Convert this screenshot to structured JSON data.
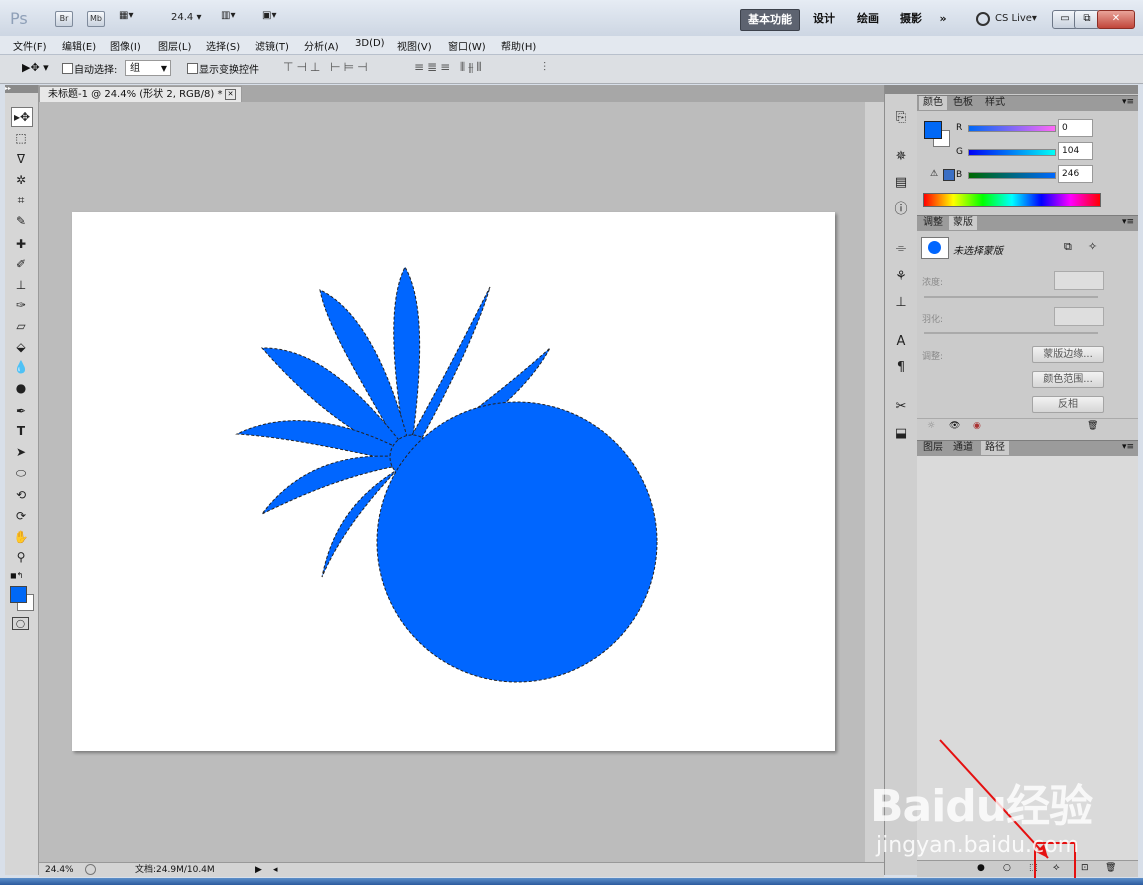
{
  "app": {
    "logo": "Ps",
    "bridge_label": "Br",
    "minibridge_label": "Mb",
    "zoom_value": "24.4",
    "workspaces": [
      "基本功能",
      "设计",
      "绘画",
      "摄影"
    ],
    "more_label": "»",
    "cslive_label": "CS Live▾"
  },
  "menu": [
    "文件(F)",
    "编辑(E)",
    "图像(I)",
    "图层(L)",
    "选择(S)",
    "滤镜(T)",
    "分析(A)",
    "3D(D)",
    "视图(V)",
    "窗口(W)",
    "帮助(H)"
  ],
  "options": {
    "auto_select_label": "自动选择:",
    "auto_select_value": "组",
    "show_transform_label": "显示变换控件"
  },
  "document": {
    "tab_title": "未标题-1 @ 24.4% (形状 2, RGB/8) *",
    "status_zoom": "24.4%",
    "status_doc": "文档:24.9M/10.4M",
    "shape_color": "#0066ff"
  },
  "color_panel": {
    "tabs": [
      "颜色",
      "色板",
      "样式"
    ],
    "r_label": "R",
    "r_value": "0",
    "g_label": "G",
    "g_value": "104",
    "b_label": "B",
    "b_value": "246",
    "fg_color": "#0068f6"
  },
  "masks_panel": {
    "tabs": [
      "调整",
      "蒙版"
    ],
    "mask_label": "未选择蒙版",
    "density_label": "浓度:",
    "feather_label": "羽化:",
    "refine_label": "调整:",
    "mask_edge_button": "蒙版边缘...",
    "color_range_button": "颜色范围...",
    "invert_button": "反相"
  },
  "layers_panel": {
    "tabs": [
      "图层",
      "通道",
      "路径"
    ]
  },
  "watermark": {
    "brand": "Baidu经验",
    "url": "jingyan.baidu.com"
  }
}
